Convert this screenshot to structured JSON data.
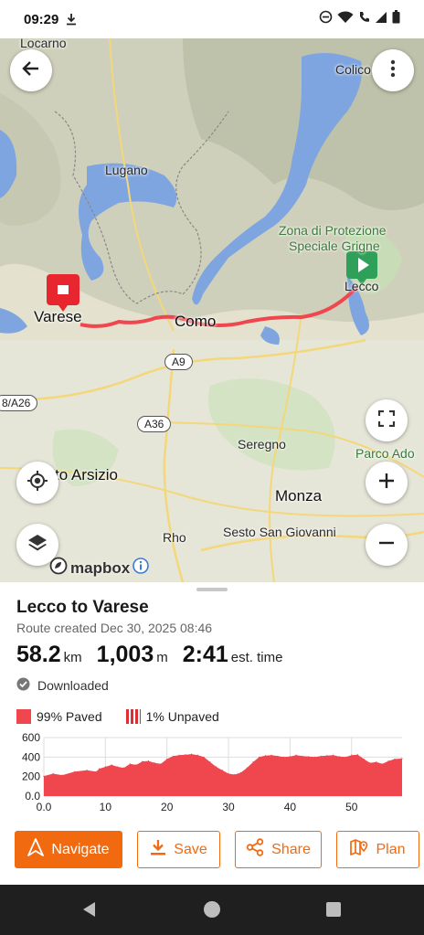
{
  "status_bar": {
    "time": "09:29",
    "icons": [
      "download-icon",
      "dnd-icon",
      "wifi-icon",
      "call-icon",
      "signal-icon",
      "battery-icon"
    ]
  },
  "map": {
    "labels": {
      "locarno": "Locarno",
      "colico": "Colico",
      "lugano": "Lugano",
      "zona1": "Zona di Protezione",
      "zona2": "Speciale Grigne",
      "lecco": "Lecco",
      "varese": "Varese",
      "como": "Como",
      "seregno": "Seregno",
      "parco": "Parco Ado",
      "arsizio": "to Arsizio",
      "monza": "Monza",
      "rho": "Rho",
      "sesto": "Sesto San Giovanni",
      "a26": "8/A26"
    },
    "roads": {
      "a9": "A9",
      "a36": "A36"
    },
    "attribution": "mapbox",
    "route_color": "#f0474f",
    "start_color": "#2ea05a",
    "end_color": "#e8262f"
  },
  "route": {
    "title": "Lecco to Varese",
    "created": "Route created Dec 30, 2025 08:46",
    "distance_value": "58.2",
    "distance_unit": "km",
    "elevation_value": "1,003",
    "elevation_unit": "m",
    "time_value": "2:41",
    "time_unit": "est. time",
    "downloaded": "Downloaded",
    "paved": "99% Paved",
    "unpaved": "1% Unpaved"
  },
  "chart_data": {
    "type": "area",
    "xlabel": "",
    "ylabel": "",
    "xlim": [
      0,
      58.2
    ],
    "ylim": [
      0,
      600
    ],
    "x_ticks": [
      "0.0",
      "10",
      "20",
      "30",
      "40",
      "50"
    ],
    "y_ticks": [
      "600",
      "400",
      "200",
      "0.0"
    ],
    "grid": true,
    "color": "#f0474f",
    "x": [
      0,
      1.5,
      3,
      5,
      7,
      8.5,
      9,
      10,
      11,
      12,
      13,
      14,
      15,
      16,
      17,
      18,
      19,
      20,
      21,
      22,
      23,
      24,
      25,
      26,
      27,
      28,
      29,
      30,
      31,
      32,
      33,
      34,
      35,
      36,
      37,
      38,
      39,
      40,
      41,
      42,
      43,
      44,
      45,
      46,
      47,
      48,
      49,
      50,
      51,
      52,
      53,
      54,
      55,
      56,
      57,
      58.2
    ],
    "y": [
      205,
      230,
      215,
      250,
      265,
      250,
      280,
      300,
      320,
      300,
      290,
      330,
      320,
      355,
      360,
      340,
      330,
      380,
      410,
      420,
      425,
      430,
      420,
      400,
      350,
      300,
      265,
      230,
      220,
      240,
      290,
      350,
      400,
      415,
      420,
      410,
      400,
      405,
      420,
      410,
      405,
      400,
      410,
      415,
      420,
      405,
      400,
      420,
      425,
      380,
      340,
      350,
      330,
      360,
      380,
      385
    ]
  },
  "actions": {
    "navigate": "Navigate",
    "save": "Save",
    "share": "Share",
    "plan": "Plan"
  }
}
